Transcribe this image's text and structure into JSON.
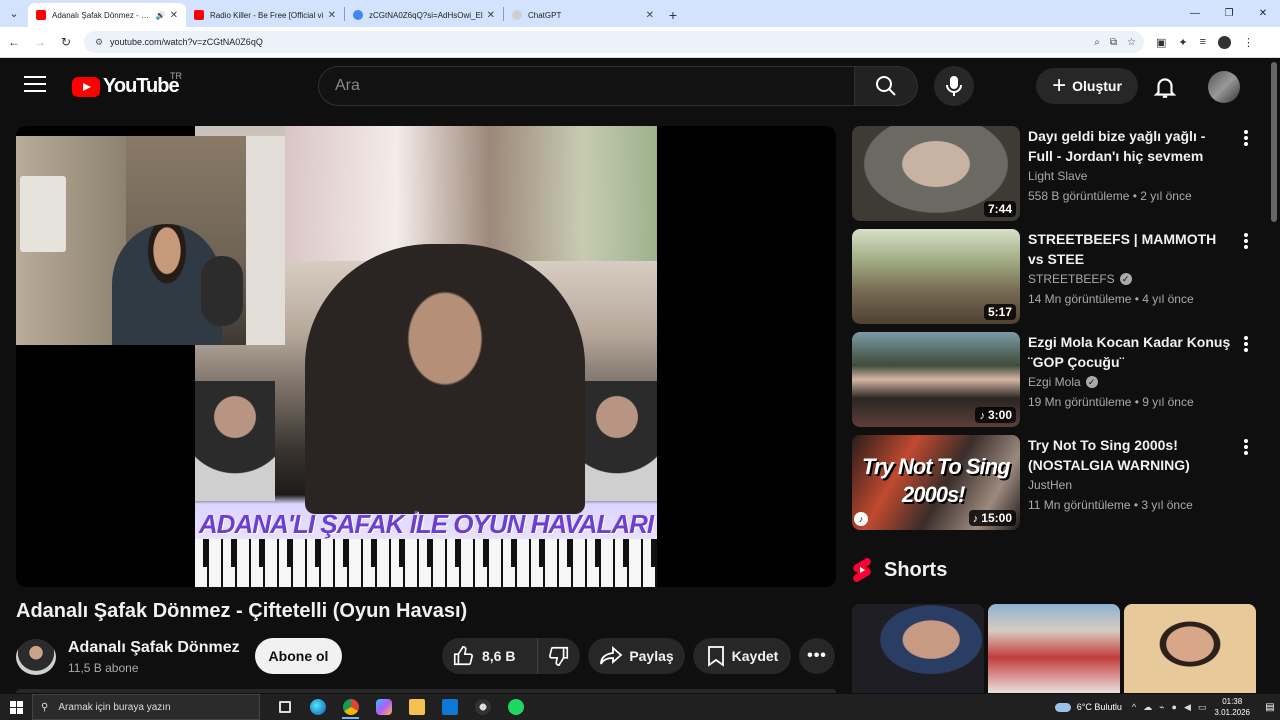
{
  "browser": {
    "tabs": [
      {
        "title": "Adanalı Şafak Dönmez - Çift",
        "favicon_color": "#ff0000",
        "active": true,
        "audio": true
      },
      {
        "title": "Radio Killer - Be Free [Official vi",
        "favicon_color": "#ff0000",
        "active": false
      },
      {
        "title": "zCGtNA0Z6qQ?si=AdHsOwi_El",
        "favicon_color": "#4285f4",
        "active": false
      },
      {
        "title": "ChatGPT",
        "favicon_color": "#cfcfcf",
        "active": false
      }
    ],
    "url": "youtube.com/watch?v=zCGtNA0Z6qQ"
  },
  "header": {
    "logo_text": "YouTube",
    "country": "TR",
    "search_placeholder": "Ara",
    "create_label": "Oluştur"
  },
  "video": {
    "banner_text": "ADANA'LI ŞAFAK İLE OYUN HAVALARI",
    "title": "Adanalı Şafak Dönmez - Çiftetelli (Oyun Havası)",
    "channel_name": "Adanalı Şafak Dönmez",
    "subscribers": "11,5 B abone",
    "subscribe_label": "Abone ol",
    "likes": "8,6 B",
    "share_label": "Paylaş",
    "save_label": "Kaydet"
  },
  "recommendations": [
    {
      "title": "Dayı geldi bize yağlı yağlı - Full - Jordan'ı hiç sevmem",
      "channel": "Light Slave",
      "verified": false,
      "views": "558 B görüntüleme",
      "age": "2 yıl önce",
      "duration": "7:44",
      "music": false
    },
    {
      "title": "STREETBEEFS | MAMMOTH vs STEE",
      "channel": "STREETBEEFS",
      "verified": true,
      "views": "14 Mn görüntüleme",
      "age": "4 yıl önce",
      "duration": "5:17",
      "music": false
    },
    {
      "title": "Ezgi Mola Kocan Kadar Konuş ¨GOP Çocuğu¨",
      "channel": "Ezgi Mola",
      "verified": true,
      "views": "19 Mn görüntüleme",
      "age": "9 yıl önce",
      "duration": "3:00",
      "music": true
    },
    {
      "title": "Try Not To Sing 2000s! (NOSTALGIA WARNING)",
      "channel": "JustHen",
      "verified": false,
      "views": "11 Mn görüntüleme",
      "age": "3 yıl önce",
      "duration": "15:00",
      "music": true,
      "thumb_text_1": "Try Not To Sing",
      "thumb_text_2": "2000s!"
    }
  ],
  "shorts": {
    "title": "Shorts"
  },
  "taskbar": {
    "search_placeholder": "Aramak için buraya yazın",
    "weather": "6°C  Bulutlu",
    "time": "01:38",
    "date": "3.01.2026"
  },
  "colors": {
    "yt_red": "#ff0000",
    "background": "#0f0f0f",
    "chip": "#272727"
  }
}
